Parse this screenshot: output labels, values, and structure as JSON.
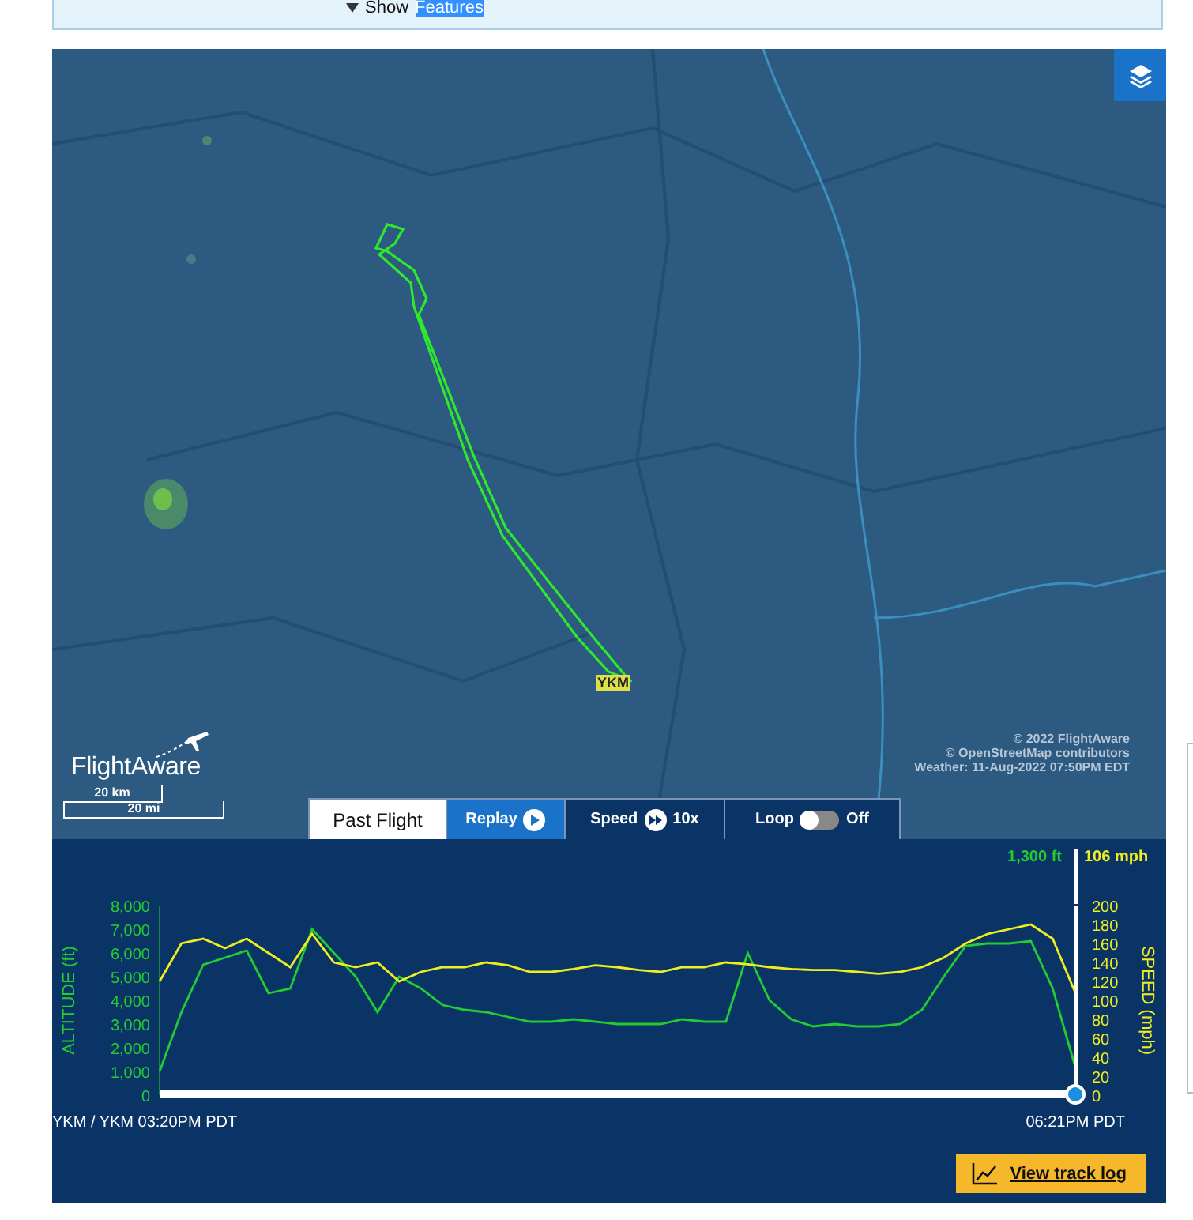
{
  "features_toggle": {
    "words": [
      {
        "text": "Show",
        "highlighted": false
      },
      {
        "text": "Features",
        "highlighted": true
      }
    ]
  },
  "map": {
    "kind": "picture",
    "airport_label": "YKM",
    "logo": "FlightAware",
    "scale": {
      "metric": "20 km",
      "imperial": "20 mi"
    },
    "attribution": [
      "© 2022 FlightAware",
      "© OpenStreetMap contributors",
      "Weather: 11-Aug-2022 07:50PM EDT"
    ]
  },
  "playback_bar": [
    {
      "kind": "tab",
      "label": "Past Flight",
      "selected": true
    },
    {
      "kind": "play",
      "label": "Replay",
      "selected": false
    },
    {
      "kind": "speed",
      "label": "Speed",
      "value": "10x",
      "selected": false
    },
    {
      "kind": "toggle",
      "label": "Loop",
      "on": false,
      "value": "Off",
      "selected": false
    }
  ],
  "profile": {
    "altitude_reading": "1,300 ft",
    "speed_reading": "106 mph",
    "start_label": "YKM / YKM 03:20PM PDT",
    "end_label": "06:21PM PDT",
    "scrubber": {
      "level": 1
    },
    "button": "View track log",
    "charts": [
      {
        "chart_data": {
          "type": "line",
          "ylabel": "ALTITUDE (ft)",
          "ylim": [
            0,
            8000
          ],
          "yticks": [
            {
              "value": 0,
              "label": "0"
            },
            {
              "value": 1000,
              "label": "1,000"
            },
            {
              "value": 2000,
              "label": "2,000"
            },
            {
              "value": 3000,
              "label": "3,000"
            },
            {
              "value": 4000,
              "label": "4,000"
            },
            {
              "value": 5000,
              "label": "5,000"
            },
            {
              "value": 6000,
              "label": "6,000"
            },
            {
              "value": 7000,
              "label": "7,000"
            },
            {
              "value": 8000,
              "label": "8,000"
            }
          ],
          "series": [
            {
              "color": "#22cc33",
              "values": [
                1000,
                3500,
                5500,
                5800,
                6100,
                4300,
                4500,
                7000,
                6000,
                5000,
                3500,
                5000,
                4500,
                3800,
                3600,
                3500,
                3300,
                3100,
                3100,
                3200,
                3100,
                3000,
                3000,
                3000,
                3200,
                3100,
                3100,
                6000,
                4000,
                3200,
                2900,
                3000,
                2900,
                2900,
                3000,
                3600,
                5000,
                6300,
                6400,
                6400,
                6500,
                4500,
                1300
              ]
            }
          ]
        }
      },
      {
        "chart_data": {
          "type": "line",
          "ylabel": "SPEED (mph)",
          "ylim": [
            0,
            200
          ],
          "yticks": [
            0,
            20,
            40,
            60,
            80,
            100,
            120,
            140,
            160,
            180,
            200
          ],
          "series": [
            {
              "color": "#eeee22",
              "values": [
                120,
                160,
                165,
                155,
                165,
                150,
                135,
                170,
                140,
                135,
                140,
                120,
                130,
                135,
                135,
                140,
                137,
                130,
                130,
                133,
                137,
                135,
                132,
                130,
                135,
                135,
                140,
                138,
                135,
                133,
                132,
                132,
                130,
                128,
                130,
                135,
                145,
                160,
                170,
                175,
                180,
                165,
                110
              ]
            }
          ]
        }
      }
    ]
  }
}
